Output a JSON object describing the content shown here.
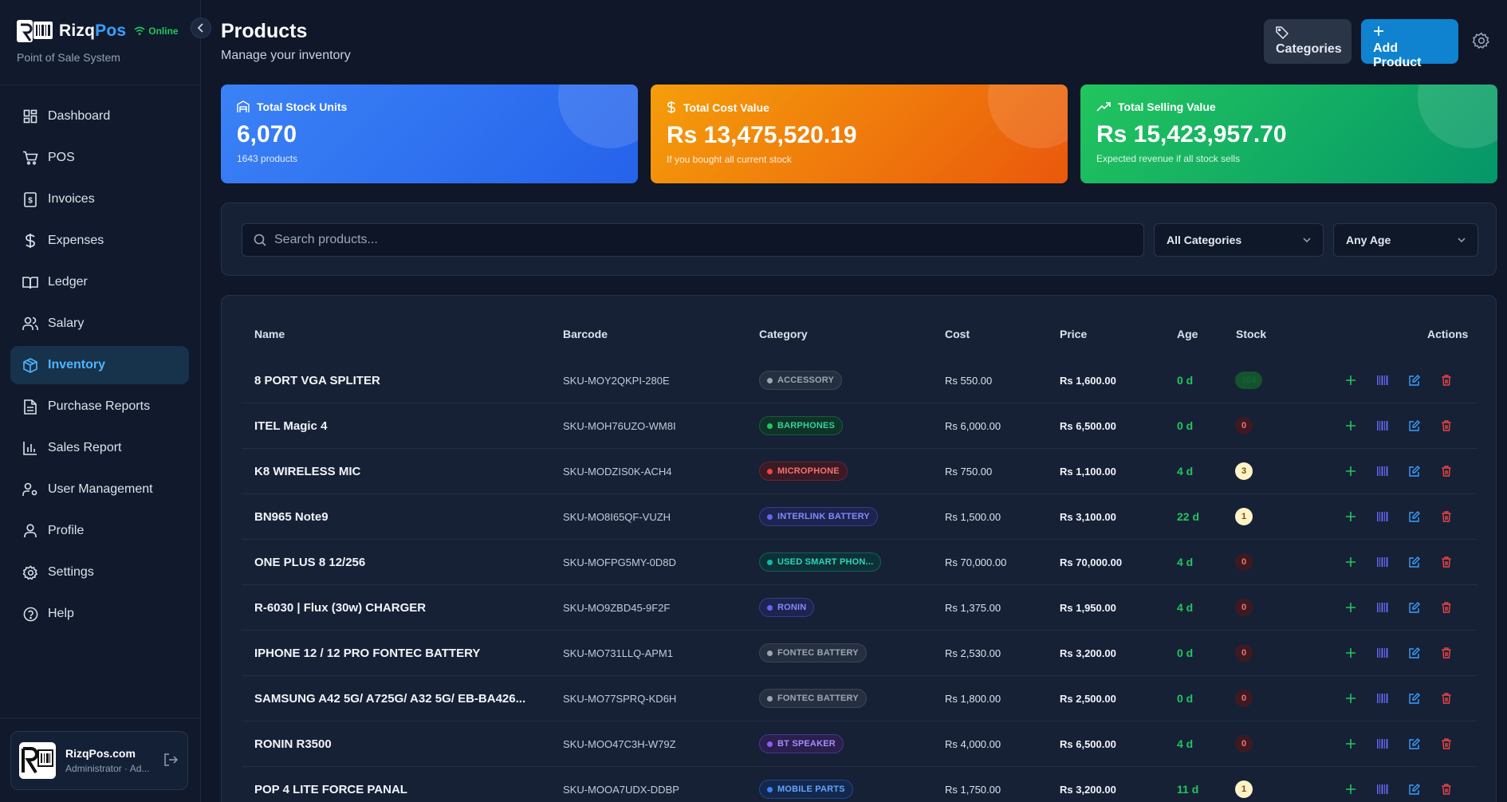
{
  "app": {
    "name_part1": "Rizq",
    "name_part2": "Pos",
    "status": "Online",
    "subtitle": "Point of Sale System"
  },
  "sidebar": {
    "items": [
      {
        "label": "Dashboard",
        "icon": "dashboard-icon",
        "active": false
      },
      {
        "label": "POS",
        "icon": "cart-icon",
        "active": false
      },
      {
        "label": "Invoices",
        "icon": "invoice-icon",
        "active": false
      },
      {
        "label": "Expenses",
        "icon": "dollar-icon",
        "active": false
      },
      {
        "label": "Ledger",
        "icon": "book-icon",
        "active": false
      },
      {
        "label": "Salary",
        "icon": "users-icon",
        "active": false
      },
      {
        "label": "Inventory",
        "icon": "box-icon",
        "active": true
      },
      {
        "label": "Purchase Reports",
        "icon": "file-icon",
        "active": false
      },
      {
        "label": "Sales Report",
        "icon": "bar-chart-icon",
        "active": false
      },
      {
        "label": "User Management",
        "icon": "user-cog-icon",
        "active": false
      },
      {
        "label": "Profile",
        "icon": "user-icon",
        "active": false
      },
      {
        "label": "Settings",
        "icon": "gear-icon",
        "active": false
      },
      {
        "label": "Help",
        "icon": "help-icon",
        "active": false
      }
    ],
    "user": {
      "name": "RizqPos.com",
      "role": "Administrator · Ad..."
    }
  },
  "header": {
    "title": "Products",
    "subtitle": "Manage your inventory",
    "categories_label": "Categories",
    "add_label": "Add Product"
  },
  "stats": {
    "stock": {
      "label": "Total Stock Units",
      "value": "6,070",
      "note": "1643 products"
    },
    "cost": {
      "label": "Total Cost Value",
      "value": "Rs 13,475,520.19",
      "note": "If you bought all current stock"
    },
    "selling": {
      "label": "Total Selling Value",
      "value": "Rs 15,423,957.70",
      "note": "Expected revenue if all stock sells"
    }
  },
  "filters": {
    "search_placeholder": "Search products...",
    "category": "All Categories",
    "age": "Any Age"
  },
  "table": {
    "headers": {
      "name": "Name",
      "barcode": "Barcode",
      "category": "Category",
      "cost": "Cost",
      "price": "Price",
      "age": "Age",
      "stock": "Stock",
      "actions": "Actions"
    },
    "rows": [
      {
        "name": "8 PORT VGA SPLITER",
        "barcode": "SKU-MOY2QKPI-280E",
        "category": "ACCESSORY",
        "cat_color": "gray",
        "cost": "Rs 550.00",
        "price": "Rs 1,600.00",
        "age": "0 d",
        "stock": "104",
        "stock_level": "high"
      },
      {
        "name": "ITEL Magic 4",
        "barcode": "SKU-MOH76UZO-WM8I",
        "category": "BARPHONES",
        "cat_color": "green",
        "cost": "Rs 6,000.00",
        "price": "Rs 6,500.00",
        "age": "0 d",
        "stock": "0",
        "stock_level": "zero"
      },
      {
        "name": "K8 WIRELESS MIC",
        "barcode": "SKU-MODZIS0K-ACH4",
        "category": "MICROPHONE",
        "cat_color": "red",
        "cost": "Rs 750.00",
        "price": "Rs 1,100.00",
        "age": "4 d",
        "stock": "3",
        "stock_level": "low"
      },
      {
        "name": "BN965 Note9",
        "barcode": "SKU-MO8I65QF-VUZH",
        "category": "INTERLINK BATTERY",
        "cat_color": "indigo",
        "cost": "Rs 1,500.00",
        "price": "Rs 3,100.00",
        "age": "22 d",
        "stock": "1",
        "stock_level": "low"
      },
      {
        "name": "ONE PLUS 8 12/256",
        "barcode": "SKU-MOFPG5MY-0D8D",
        "category": "USED SMART PHON...",
        "cat_color": "teal",
        "cost": "Rs 70,000.00",
        "price": "Rs 70,000.00",
        "age": "4 d",
        "stock": "0",
        "stock_level": "zero"
      },
      {
        "name": "R-6030 | Flux (30w) CHARGER",
        "barcode": "SKU-MO9ZBD45-9F2F",
        "category": "RONIN",
        "cat_color": "indigo",
        "cost": "Rs 1,375.00",
        "price": "Rs 1,950.00",
        "age": "4 d",
        "stock": "0",
        "stock_level": "zero"
      },
      {
        "name": "IPHONE 12 / 12 PRO FONTEC BATTERY",
        "barcode": "SKU-MO731LLQ-APM1",
        "category": "FONTEC BATTERY",
        "cat_color": "gray",
        "cost": "Rs 2,530.00",
        "price": "Rs 3,200.00",
        "age": "0 d",
        "stock": "0",
        "stock_level": "zero"
      },
      {
        "name": "SAMSUNG A42 5G/ A725G/ A32 5G/ EB-BA426...",
        "barcode": "SKU-MO77SPRQ-KD6H",
        "category": "FONTEC BATTERY",
        "cat_color": "gray",
        "cost": "Rs 1,800.00",
        "price": "Rs 2,500.00",
        "age": "0 d",
        "stock": "0",
        "stock_level": "zero"
      },
      {
        "name": "RONIN R3500",
        "barcode": "SKU-MOO47C3H-W79Z",
        "category": "BT SPEAKER",
        "cat_color": "purple",
        "cost": "Rs 4,000.00",
        "price": "Rs 6,500.00",
        "age": "4 d",
        "stock": "0",
        "stock_level": "zero"
      },
      {
        "name": "POP 4 LITE FORCE PANAL",
        "barcode": "SKU-MOOA7UDX-DDBP",
        "category": "MOBILE PARTS",
        "cat_color": "blue",
        "cost": "Rs 1,750.00",
        "price": "Rs 3,200.00",
        "age": "11 d",
        "stock": "1",
        "stock_level": "low"
      }
    ]
  },
  "colors": {
    "accent": "#0f82d0",
    "bg": "#0f1729",
    "age_green": "#22c55e"
  }
}
